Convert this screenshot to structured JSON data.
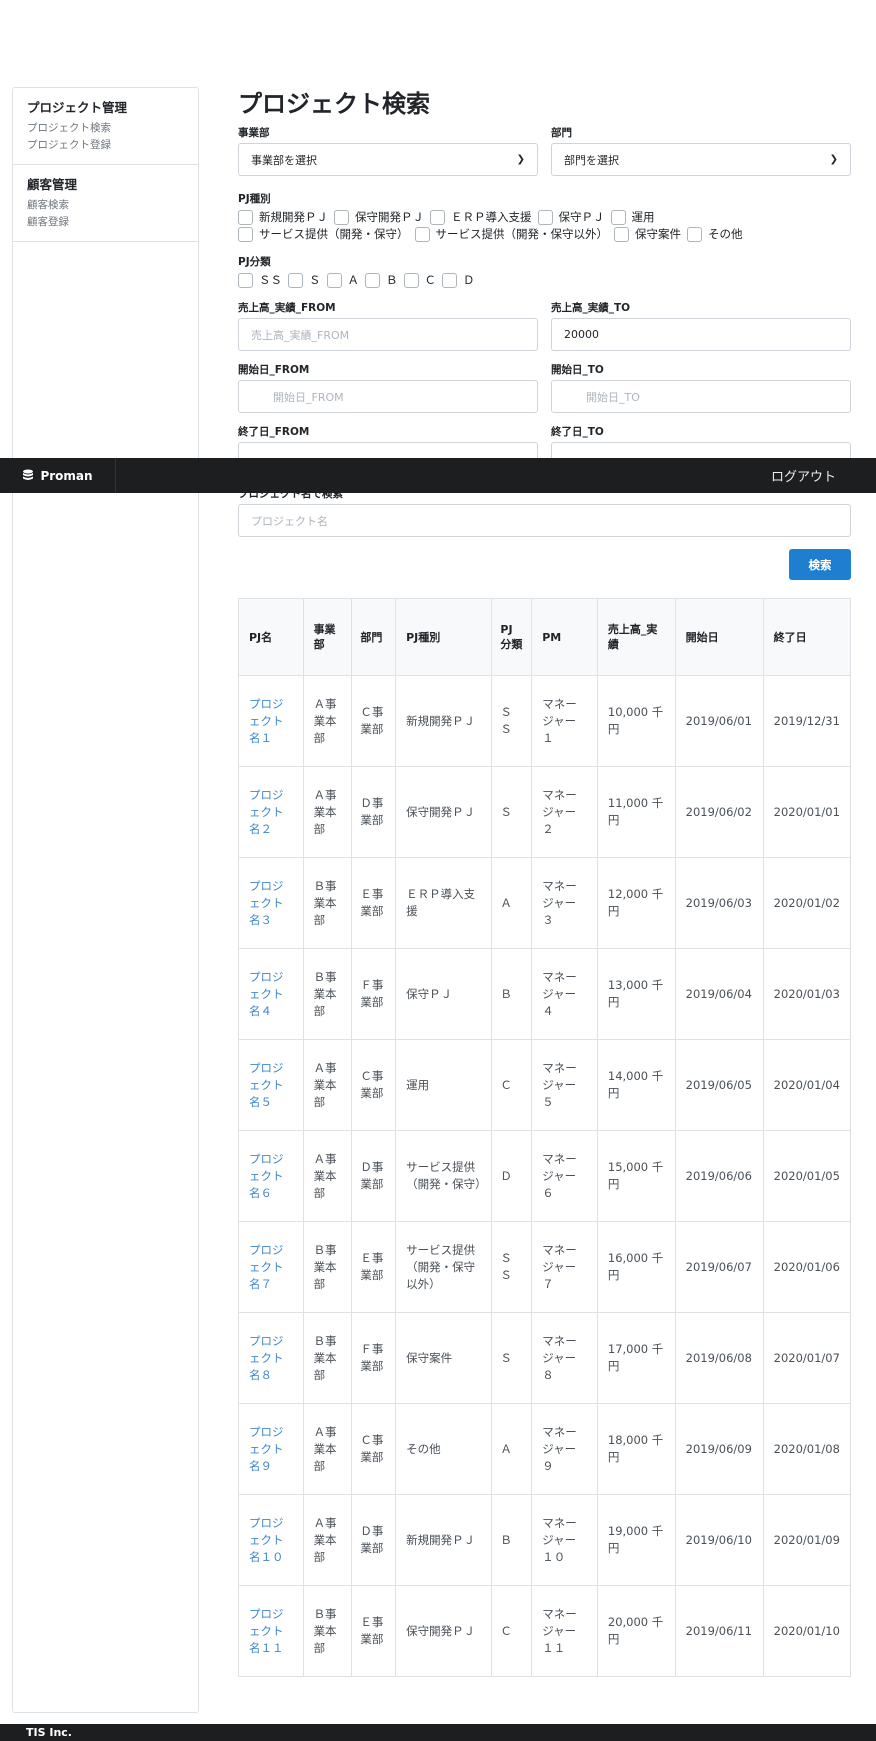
{
  "sidebar": {
    "groups": [
      {
        "title": "プロジェクト管理",
        "links": [
          "プロジェクト検索",
          "プロジェクト登録"
        ]
      },
      {
        "title": "顧客管理",
        "links": [
          "顧客検索",
          "顧客登録"
        ]
      }
    ]
  },
  "page_title": "プロジェクト検索",
  "form": {
    "division_label": "事業部",
    "division_value": "事業部を選択",
    "department_label": "部門",
    "department_value": "部門を選択",
    "pj_type_label": "PJ種別",
    "pj_types_line1": [
      "新規開発ＰＪ",
      "保守開発ＰＪ",
      "ＥＲＰ導入支援",
      "保守ＰＪ",
      "運用"
    ],
    "pj_types_line2": [
      "サービス提供（開発・保守）",
      "サービス提供（開発・保守以外）",
      "保守案件",
      "その他"
    ],
    "pj_class_label": "PJ分類",
    "pj_classes": [
      "ＳＳ",
      "Ｓ",
      "Ａ",
      "Ｂ",
      "Ｃ",
      "Ｄ"
    ],
    "sales_from_label": "売上高_実績_FROM",
    "sales_from_placeholder": "売上高_実績_FROM",
    "sales_to_label": "売上高_実績_TO",
    "sales_to_value": "20000",
    "start_from_label": "開始日_FROM",
    "start_from_placeholder": "開始日_FROM",
    "start_to_label": "開始日_TO",
    "start_to_placeholder": "開始日_TO",
    "end_from_label": "終了日_FROM",
    "end_to_label": "終了日_TO",
    "name_label": "プロジェクト名で検索",
    "name_placeholder": "プロジェクト名",
    "search_button": "検索"
  },
  "table": {
    "headers": [
      "PJ名",
      "事業部",
      "部門",
      "PJ種別",
      "PJ分類",
      "PM",
      "売上高_実績",
      "開始日",
      "終了日"
    ],
    "rows": [
      [
        "プロジェクト名１",
        "Ａ事業本部",
        "Ｃ事業部",
        "新規開発ＰＪ",
        "ＳＳ",
        "マネージャー１",
        "10,000 千円",
        "2019/06/01",
        "2019/12/31"
      ],
      [
        "プロジェクト名２",
        "Ａ事業本部",
        "Ｄ事業部",
        "保守開発ＰＪ",
        "Ｓ",
        "マネージャー２",
        "11,000 千円",
        "2019/06/02",
        "2020/01/01"
      ],
      [
        "プロジェクト名３",
        "Ｂ事業本部",
        "Ｅ事業部",
        "ＥＲＰ導入支援",
        "Ａ",
        "マネージャー３",
        "12,000 千円",
        "2019/06/03",
        "2020/01/02"
      ],
      [
        "プロジェクト名４",
        "Ｂ事業本部",
        "Ｆ事業部",
        "保守ＰＪ",
        "Ｂ",
        "マネージャー４",
        "13,000 千円",
        "2019/06/04",
        "2020/01/03"
      ],
      [
        "プロジェクト名５",
        "Ａ事業本部",
        "Ｃ事業部",
        "運用",
        "Ｃ",
        "マネージャー５",
        "14,000 千円",
        "2019/06/05",
        "2020/01/04"
      ],
      [
        "プロジェクト名６",
        "Ａ事業本部",
        "Ｄ事業部",
        "サービス提供（開発・保守）",
        "Ｄ",
        "マネージャー６",
        "15,000 千円",
        "2019/06/06",
        "2020/01/05"
      ],
      [
        "プロジェクト名７",
        "Ｂ事業本部",
        "Ｅ事業部",
        "サービス提供（開発・保守以外）",
        "ＳＳ",
        "マネージャー７",
        "16,000 千円",
        "2019/06/07",
        "2020/01/06"
      ],
      [
        "プロジェクト名８",
        "Ｂ事業本部",
        "Ｆ事業部",
        "保守案件",
        "Ｓ",
        "マネージャー８",
        "17,000 千円",
        "2019/06/08",
        "2020/01/07"
      ],
      [
        "プロジェクト名９",
        "Ａ事業本部",
        "Ｃ事業部",
        "その他",
        "Ａ",
        "マネージャー９",
        "18,000 千円",
        "2019/06/09",
        "2020/01/08"
      ],
      [
        "プロジェクト名１０",
        "Ａ事業本部",
        "Ｄ事業部",
        "新規開発ＰＪ",
        "Ｂ",
        "マネージャー１０",
        "19,000 千円",
        "2019/06/10",
        "2020/01/09"
      ],
      [
        "プロジェクト名１１",
        "Ｂ事業本部",
        "Ｅ事業部",
        "保守開発ＰＪ",
        "Ｃ",
        "マネージャー１１",
        "20,000 千円",
        "2019/06/11",
        "2020/01/10"
      ]
    ]
  },
  "navbar": {
    "brand": "Proman",
    "logout": "ログアウト"
  },
  "footer": {
    "text": "TIS Inc."
  },
  "colors": {
    "link": "#3e86cf",
    "primary_button": "#1e7fd0",
    "navbar": "#1d1e20"
  },
  "icons": {
    "brand": "database-icon",
    "select": "chevron-down-icon"
  }
}
